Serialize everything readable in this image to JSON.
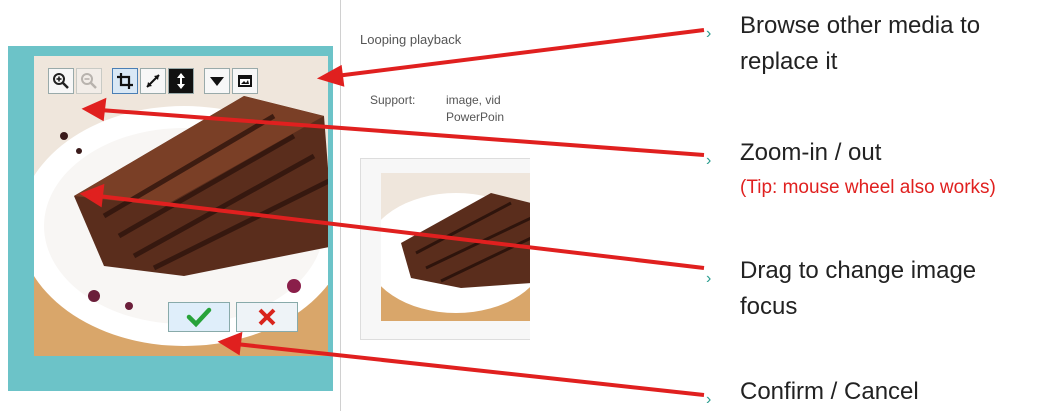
{
  "panel": {
    "looping_label": "Looping playback",
    "support_label": "Support:",
    "support_value_line1": "image, vid",
    "support_value_line2": "PowerPoin"
  },
  "toolbar": {
    "items": [
      "zoom-in-icon",
      "zoom-out-icon",
      "crop-icon",
      "fit-diagonal-icon",
      "fit-vertical-icon",
      "dropdown-icon",
      "browse-media-icon"
    ]
  },
  "callouts": {
    "browse_line1": "Browse other media to",
    "browse_line2": "replace it",
    "zoom": "Zoom-in / out",
    "tip": "(Tip: mouse wheel also works)",
    "drag_line1": "Drag to change image",
    "drag_line2": "focus",
    "confirm": "Confirm / Cancel",
    "chevron": "›"
  },
  "colors": {
    "arrow": "#e0201f",
    "tip": "#e0201f",
    "chevron": "#2a9d8f",
    "frame": "#6cc3c8",
    "confirm_check": "#27a33a",
    "cancel_x": "#d9241c"
  }
}
